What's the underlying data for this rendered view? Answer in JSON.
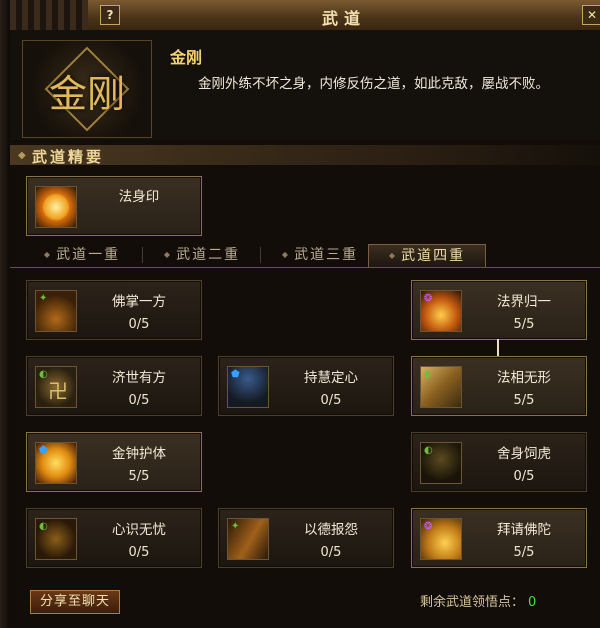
{
  "window": {
    "title": "武道",
    "help_label": "?",
    "close_label": "✕"
  },
  "header": {
    "emblem_text": "金刚",
    "skill_name": "金刚",
    "description": "金刚外练不坏之身，内修反伤之道，如此克敌，屡战不败。"
  },
  "essential": {
    "section_title": "武道精要",
    "skill": {
      "name": "法身印",
      "icon": "golden-seal-icon"
    }
  },
  "tabs": [
    {
      "label": "武道一重",
      "active": false
    },
    {
      "label": "武道二重",
      "active": false
    },
    {
      "label": "武道三重",
      "active": false
    },
    {
      "label": "武道四重",
      "active": true
    }
  ],
  "skills": [
    {
      "name": "佛掌一方",
      "level": "0/5",
      "icon": "buddha-palm-icon",
      "active": false
    },
    {
      "name": "法界归一",
      "level": "5/5",
      "icon": "dharma-realm-icon",
      "active": true
    },
    {
      "name": "济世有方",
      "level": "0/5",
      "icon": "swastika-icon",
      "active": false
    },
    {
      "name": "持慧定心",
      "level": "0/5",
      "icon": "wisdom-figure-icon",
      "active": false
    },
    {
      "name": "法相无形",
      "level": "5/5",
      "icon": "dharma-form-icon",
      "active": true
    },
    {
      "name": "金钟护体",
      "level": "5/5",
      "icon": "golden-bell-icon",
      "active": true
    },
    {
      "name": "舍身饲虎",
      "level": "0/5",
      "icon": "sacrifice-tiger-icon",
      "active": false
    },
    {
      "name": "心识无忧",
      "level": "0/5",
      "icon": "mind-serene-icon",
      "active": false
    },
    {
      "name": "以德报怨",
      "level": "0/5",
      "icon": "virtue-repay-icon",
      "active": false
    },
    {
      "name": "拜请佛陀",
      "level": "5/5",
      "icon": "pray-buddha-icon",
      "active": true
    }
  ],
  "footer": {
    "share_label": "分享至聊天",
    "points_label": "剩余武道领悟点：",
    "points_value": "0"
  },
  "colors": {
    "accent_gold": "#f5d36a",
    "points_green": "#3fe83a",
    "border_active": "#8b7048"
  }
}
